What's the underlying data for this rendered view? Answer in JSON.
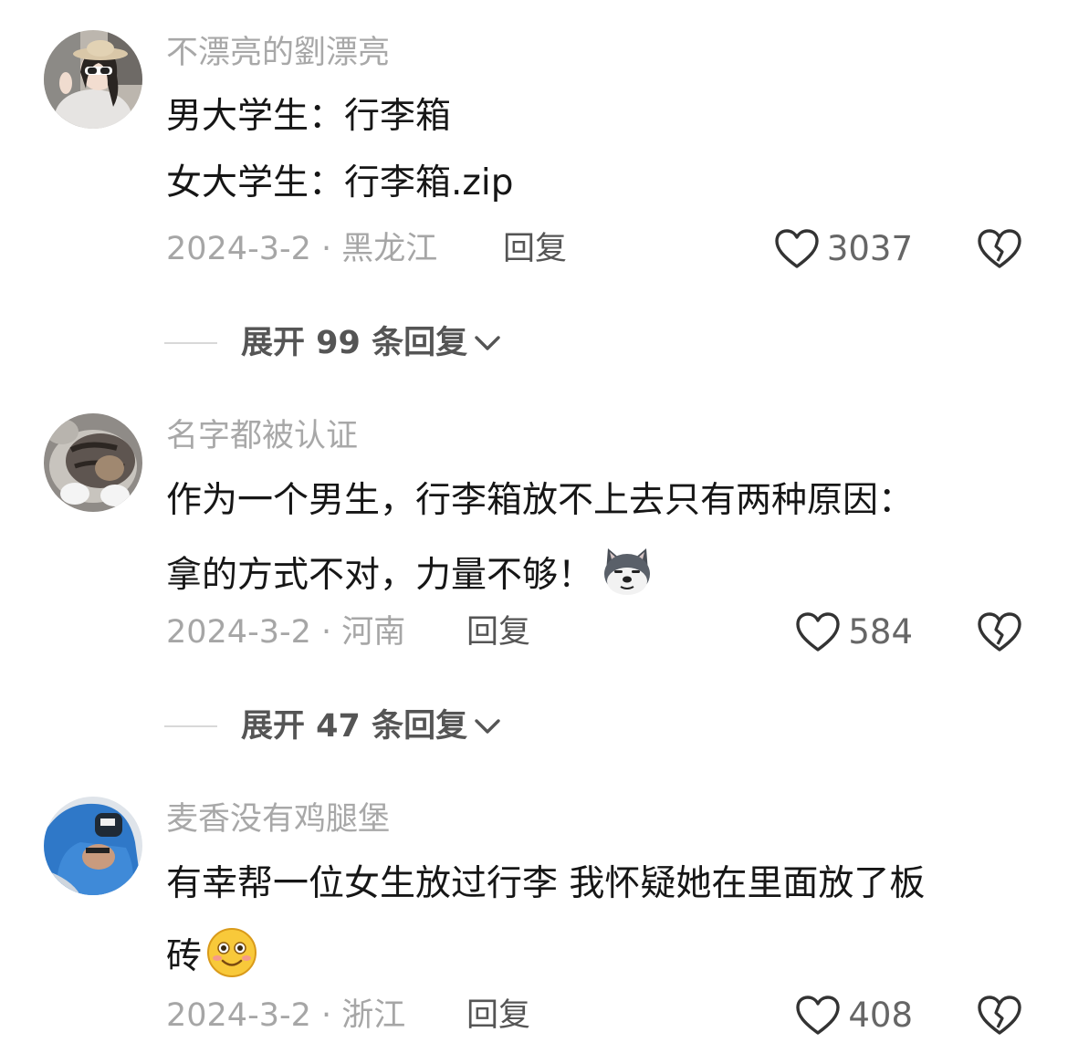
{
  "comments": [
    {
      "username": "不漂亮的劉漂亮",
      "lines": [
        "男大学生：行李箱",
        "女大学生：行李箱.zip"
      ],
      "date_location": "2024-3-2 · 黑龙江",
      "reply_label": "回复",
      "likes": "3037",
      "expand_label": "展开 99 条回复"
    },
    {
      "username": "名字都被认证",
      "lines": [
        "作为一个男生，行李箱放不上去只有两种原因：",
        "拿的方式不对，力量不够！"
      ],
      "date_location": "2024-3-2 · 河南",
      "reply_label": "回复",
      "likes": "584",
      "expand_label": "展开 47 条回复"
    },
    {
      "username": "麦香没有鸡腿堡",
      "lines": [
        "有幸帮一位女生放过行李 我怀疑她在里面放了板",
        "砖"
      ],
      "date_location": "2024-3-2 · 浙江",
      "reply_label": "回复",
      "likes": "408"
    }
  ],
  "icons": {
    "like": "heart-outline-icon",
    "dislike": "broken-heart-icon",
    "expand": "chevron-down-icon",
    "emoji_1": "husky-dog-emoji",
    "emoji_2": "smiling-face-emoji"
  },
  "colors": {
    "text_primary": "#161616",
    "text_secondary": "#a8a8a8",
    "action": "#555555"
  }
}
